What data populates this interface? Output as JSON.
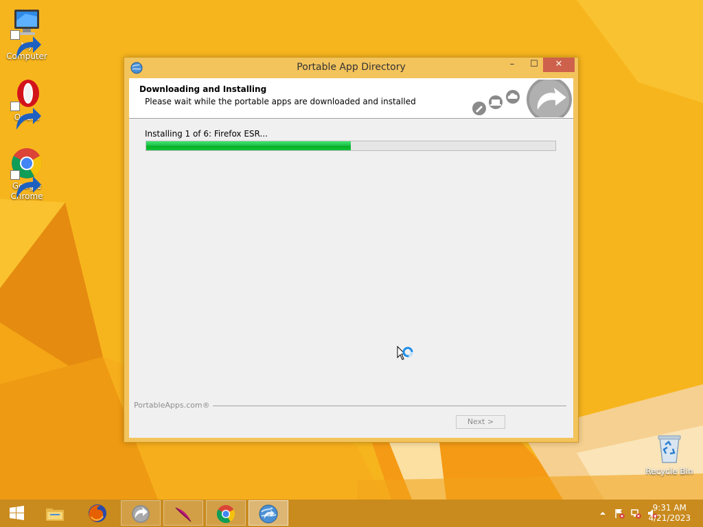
{
  "desktop": {
    "icons": [
      {
        "label": "My Computer"
      },
      {
        "label": "Opera"
      },
      {
        "label": "Google Chrome"
      }
    ],
    "recycle_bin": {
      "label": "Recycle Bin"
    }
  },
  "window": {
    "title": "Portable App Directory",
    "buttons": {
      "minimize": "–",
      "maximize": "☐",
      "close": "✕"
    },
    "header": {
      "title": "Downloading and Installing",
      "subtitle": "Please wait while the portable apps are downloaded and installed"
    },
    "status": "Installing 1 of 6: Firefox ESR...",
    "progress": {
      "value": 0.5
    },
    "footer": {
      "brand": "PortableApps.com®",
      "next_label": "Next >"
    }
  },
  "taskbar": {
    "items": [
      {
        "name": "file-explorer",
        "state": "pinned"
      },
      {
        "name": "firefox",
        "state": "pinned"
      },
      {
        "name": "portableapps",
        "state": "open"
      },
      {
        "name": "feather-app",
        "state": "open"
      },
      {
        "name": "chrome",
        "state": "open"
      },
      {
        "name": "portable-app-directory",
        "state": "active"
      }
    ],
    "clock": {
      "time": "9:31 AM",
      "date": "4/21/2023"
    }
  },
  "colors": {
    "wallpaper": "#f5b21c",
    "window_frame": "#f3c35c",
    "progress_fill": "#06b025",
    "close_button": "#c7504a"
  }
}
